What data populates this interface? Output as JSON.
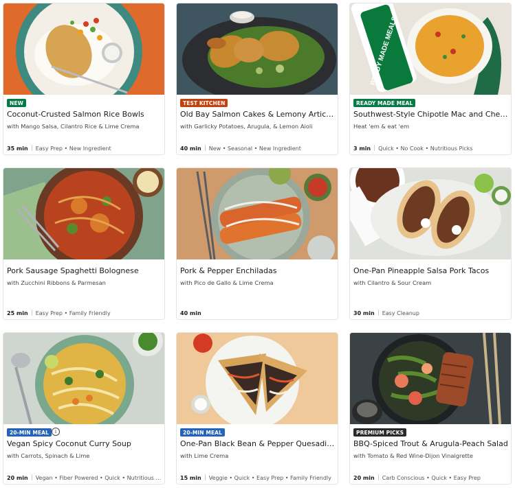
{
  "colors": {
    "badge_new": "#067a46",
    "badge_test_kitchen": "#c2410c",
    "badge_ready_made": "#067a46",
    "badge_20_min": "#2563b8",
    "badge_premium": "#2a2a2a"
  },
  "cards": [
    {
      "badge": "NEW",
      "title": "Coconut-Crusted Salmon Rice Bowls",
      "subtitle": "with Mango Salsa, Cilantro Rice & Lime Crema",
      "time": "35 min",
      "tags": "Easy Prep • New Ingredient"
    },
    {
      "badge": "TEST KITCHEN",
      "title": "Old Bay Salmon Cakes & Lemony Artichoke Salad",
      "subtitle": "with Garlicky Potatoes, Arugula, & Lemon Aioli",
      "time": "40 min",
      "tags": "New • Seasonal • New Ingredient"
    },
    {
      "badge": "READY MADE MEAL",
      "title": "Southwest-Style Chipotle Mac and Cheese",
      "subtitle": "Heat 'em & eat 'em",
      "time": "3 min",
      "tags": "Quick • No Cook • Nutritious Picks",
      "package_text": "READY MADE MEALS"
    },
    {
      "badge": "",
      "title": "Pork Sausage Spaghetti Bolognese",
      "subtitle": "with Zucchini Ribbons & Parmesan",
      "time": "25 min",
      "tags": "Easy Prep • Family Friendly"
    },
    {
      "badge": "",
      "title": "Pork & Pepper Enchiladas",
      "subtitle": "with Pico de Gallo & Lime Crema",
      "time": "40 min",
      "tags": ""
    },
    {
      "badge": "",
      "title": "One-Pan Pineapple Salsa Pork Tacos",
      "subtitle": "with Cilantro & Sour Cream",
      "time": "30 min",
      "tags": "Easy Cleanup"
    },
    {
      "badge": "20-MIN MEAL",
      "title": "Vegan Spicy Coconut Curry Soup",
      "subtitle": "with Carrots, Spinach & Lime",
      "time": "20 min",
      "tags": "Vegan • Fiber Powered • Quick • Nutritious Picks"
    },
    {
      "badge": "20-MIN MEAL",
      "title": "One-Pan Black Bean & Pepper Quesadillas",
      "subtitle": "with Lime Crema",
      "time": "15 min",
      "tags": "Veggie • Quick • Easy Prep • Family Friendly"
    },
    {
      "badge": "PREMIUM PICKS",
      "title": "BBQ-Spiced Trout & Arugula-Peach Salad",
      "subtitle": "with Tomato & Red Wine-Dijon Vinaigrette",
      "time": "20 min",
      "tags": "Carb Conscious • Quick • Easy Prep"
    }
  ]
}
